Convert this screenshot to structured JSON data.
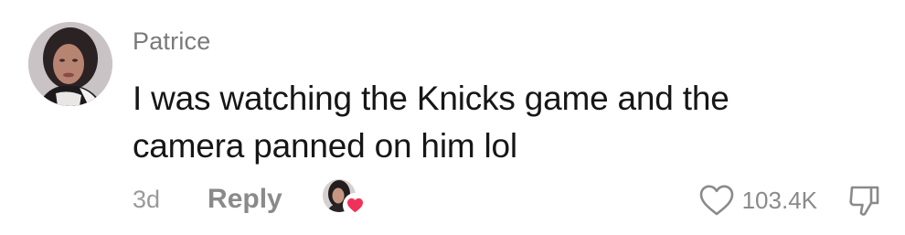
{
  "comment": {
    "username": "Patrice",
    "text": "I was watching the Knicks game and the camera panned on him lol",
    "time": "3d",
    "reply_label": "Reply",
    "like_count": "103.4K",
    "creator_liked": true
  },
  "colors": {
    "username": "#7a7a7a",
    "text": "#161616",
    "meta": "#9a9a9a",
    "heart_badge": "#f0325a"
  },
  "icons": {
    "avatar": "user-avatar",
    "creator": "creator-avatar",
    "creator_heart": "heart-icon",
    "like": "heart-outline-icon",
    "dislike": "thumbs-down-icon"
  }
}
